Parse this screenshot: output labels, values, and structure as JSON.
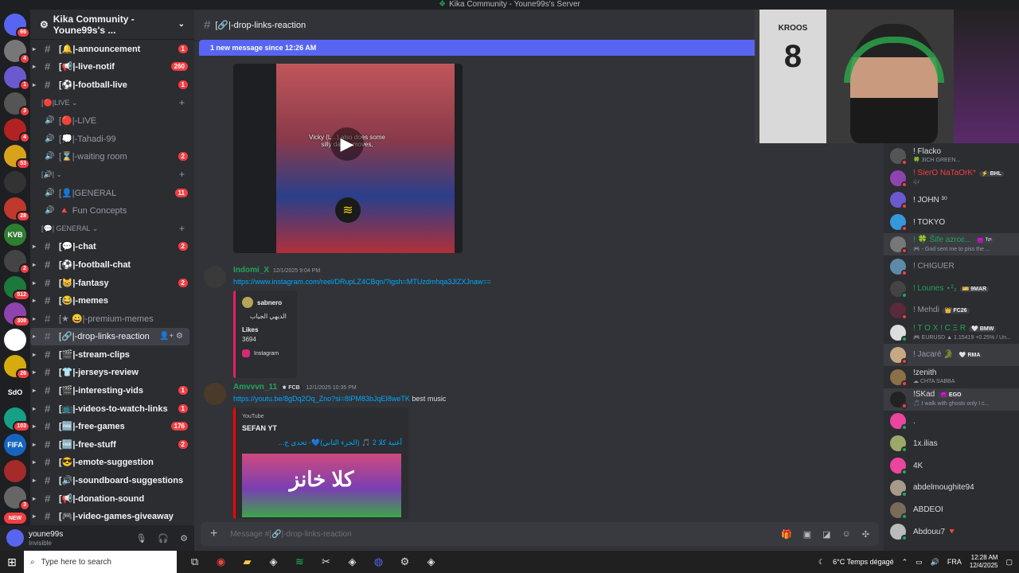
{
  "window": {
    "title": "Kika Community - Youne99s's Server"
  },
  "servers": [
    {
      "label": "",
      "badge": "66",
      "color": "#5865f2"
    },
    {
      "label": "",
      "badge": "4",
      "color": "#777777"
    },
    {
      "label": "",
      "badge": "1",
      "color": "#6a5acd"
    },
    {
      "label": "",
      "badge": "3",
      "color": "#555555"
    },
    {
      "label": "",
      "badge": "4",
      "color": "#b22222"
    },
    {
      "label": "",
      "badge": "53",
      "color": "#d9a21b"
    },
    {
      "label": "",
      "badge": "",
      "color": "#333333"
    },
    {
      "label": "",
      "badge": "28",
      "color": "#c0392b"
    },
    {
      "label": "KVB",
      "badge": "",
      "color": "#2e7d32"
    },
    {
      "label": "",
      "badge": "2",
      "color": "#444444"
    },
    {
      "label": "",
      "badge": "512",
      "color": "#1b7a3a"
    },
    {
      "label": "",
      "badge": "308",
      "color": "#8e44ad"
    },
    {
      "label": "",
      "badge": "",
      "color": "#ffffff"
    },
    {
      "label": "",
      "badge": "26",
      "color": "#d4ac0d"
    },
    {
      "label": "SdO",
      "badge": "",
      "color": "#1e1f22"
    },
    {
      "label": "",
      "badge": "103",
      "color": "#16a085"
    },
    {
      "label": "FIFA",
      "badge": "",
      "color": "#1565c0"
    },
    {
      "label": "",
      "badge": "",
      "color": "#a52a2a"
    },
    {
      "label": "",
      "badge": "3",
      "color": "#666666"
    },
    {
      "label": "NEW",
      "badge": "",
      "color": "#f23f43"
    }
  ],
  "guild": {
    "name": "Kika Community - Youne99s's ..."
  },
  "channels": [
    {
      "type": "text",
      "name": "[🔔|-announcement",
      "badge": "1",
      "state": "bright"
    },
    {
      "type": "text",
      "name": "[📢|-live-notif",
      "badge": "260",
      "state": "bright"
    },
    {
      "type": "text",
      "name": "[⚽|-football-live",
      "badge": "1",
      "state": "bright"
    },
    {
      "type": "cat",
      "name": "[🔴|LIVE ⌄"
    },
    {
      "type": "voice",
      "name": "[🔴|-LIVE",
      "badge": "",
      "state": "muted"
    },
    {
      "type": "voice",
      "name": "[💭|-Tahadi-99",
      "badge": "",
      "state": "muted"
    },
    {
      "type": "voice",
      "name": "[⌛|-waiting room",
      "badge": "2",
      "state": "muted"
    },
    {
      "type": "cat",
      "name": "[🔊| ⌄"
    },
    {
      "type": "voice",
      "name": "[👤|GENERAL",
      "badge": "11",
      "state": "muted"
    },
    {
      "type": "voice",
      "name": "🔺 Fun Concepts",
      "badge": "",
      "state": "muted"
    },
    {
      "type": "cat",
      "name": "[💬| GENERAL ⌄"
    },
    {
      "type": "text",
      "name": "[💬|-chat",
      "badge": "2",
      "state": "bright"
    },
    {
      "type": "text",
      "name": "[⚽|-football-chat",
      "badge": "",
      "state": "bright"
    },
    {
      "type": "text",
      "name": "[😸|-fantasy",
      "badge": "2",
      "state": "bright"
    },
    {
      "type": "text",
      "name": "[😂|-memes",
      "badge": "",
      "state": "bright"
    },
    {
      "type": "text",
      "name": "[★ 😀|-premium-memes",
      "badge": "",
      "state": "muted"
    },
    {
      "type": "text",
      "name": "[🔗|-drop-links-reaction",
      "badge": "",
      "state": "active"
    },
    {
      "type": "text",
      "name": "[🎬|-stream-clips",
      "badge": "",
      "state": "bright"
    },
    {
      "type": "text",
      "name": "[👕|-jerseys-review",
      "badge": "",
      "state": "bright"
    },
    {
      "type": "text",
      "name": "[🎬|-interesting-vids",
      "badge": "1",
      "state": "bright"
    },
    {
      "type": "text",
      "name": "[📺|-videos-to-watch-links",
      "badge": "1",
      "state": "bright"
    },
    {
      "type": "text",
      "name": "[🆓|-free-games",
      "badge": "176",
      "state": "bright"
    },
    {
      "type": "text",
      "name": "[🆓|-free-stuff",
      "badge": "2",
      "state": "bright"
    },
    {
      "type": "text",
      "name": "[😎|-emote-suggestion",
      "badge": "",
      "state": "bright"
    },
    {
      "type": "text",
      "name": "[🔊|-soundboard-suggestions",
      "badge": "",
      "state": "bright"
    },
    {
      "type": "text",
      "name": "[📢|-donation-sound",
      "badge": "",
      "state": "bright"
    },
    {
      "type": "text",
      "name": "[🎮|-video-games-giveaway",
      "badge": "",
      "state": "bright"
    }
  ],
  "user": {
    "name": "youne99s",
    "status": "Invisible"
  },
  "header": {
    "channel": "[🔗|-drop-links-reaction"
  },
  "newbar": {
    "text": "1 new message since 12:26 AM"
  },
  "video": {
    "caption": "Vicky (L...) also does some silly dance moves,"
  },
  "messages": [
    {
      "author": "Indomi_X",
      "color": "#23a55a",
      "tag": "",
      "time": "12/1/2025 9:04 PM",
      "link": "https://www.instagram.com/reel/DRupLZ4CBqn/?igsh=MTUzdmhqa3JlZXJnaw==",
      "text": "",
      "embed": {
        "author": "sabnero",
        "ar": "الديهي الجياب",
        "likes_label": "Likes",
        "likes": "3694",
        "provider": "Instagram"
      }
    },
    {
      "author": "Amvvvn_11",
      "color": "#23a55a",
      "tag": "⚜ FCB",
      "time": "12/1/2025 10:35 PM",
      "link": "https://youtu.be/8gDq2Oq_Zno?si=8IPM83bJqEI8weTK",
      "text": "best music",
      "embed": {
        "provider": "YouTube",
        "channel": "SEFAN YT",
        "title": "أغنية كلا 2 🎵 (الجزء الثاني)💙- تحدي ج...",
        "thumb": "كلا خانز"
      }
    }
  ],
  "composer": {
    "placeholder": "Message #[🔗|-drop-links-reaction"
  },
  "cam": {
    "shirt_name": "KROOS",
    "shirt_num": "8"
  },
  "members": [
    {
      "name": "! Flacko",
      "sub": "🍀 3ICH GREEN...",
      "color": "#dbdee1",
      "tag": "",
      "av": "#555",
      "st": "#f23f43"
    },
    {
      "name": "! SierO NaTaOrK*",
      "sub": "🎶",
      "color": "#f23f43",
      "tag": "⚡ BHL",
      "av": "#8e44ad",
      "st": "#f23f43"
    },
    {
      "name": "! JOHN ³⁰",
      "sub": "",
      "color": "#dbdee1",
      "tag": "",
      "av": "#6a5acd",
      "st": "#f23f43"
    },
    {
      "name": "! TOKYO",
      "sub": "",
      "color": "#dbdee1",
      "tag": "",
      "av": "#3498db",
      "st": "#f23f43"
    },
    {
      "name": "! 🍀 Ŝife azroɛ...",
      "sub": "🎮 - God sent me to piss the ...",
      "color": "#23a55a",
      "tag": "😈 ᵀᶻ¹",
      "av": "#777",
      "st": "#f23f43",
      "hl": true
    },
    {
      "name": "! CHIGUER",
      "sub": "",
      "color": "#949ba4",
      "tag": "",
      "av": "#5d8aa8",
      "st": "#f23f43"
    },
    {
      "name": "! Lounes ⋆²₂",
      "sub": "",
      "color": "#23a55a",
      "tag": "🎫 9MAR",
      "av": "#444",
      "st": "#23a55a"
    },
    {
      "name": "! Mehdi",
      "sub": "",
      "color": "#949ba4",
      "tag": "👑 FC26",
      "av": "#5a2a3a",
      "st": "#f23f43"
    },
    {
      "name": "! T O X ! C Ξ R",
      "sub": "🎮 EURUSD ▲ 1.15419 +0.25% / Un...",
      "color": "#23a55a",
      "tag": "🤍 BMW",
      "av": "#ddd",
      "st": "#23a55a"
    },
    {
      "name": "! Jacaré 🐊",
      "sub": "",
      "color": "#949ba4",
      "tag": "🤍 RMA",
      "av": "#c8a882",
      "st": "#f23f43",
      "hl": true
    },
    {
      "name": "!zenith",
      "sub": "☁ CHTA SABBA",
      "color": "#dbdee1",
      "tag": "",
      "av": "#8b6f47",
      "st": "#f23f43"
    },
    {
      "name": "!SKad",
      "sub": "🎵 I walk with ghosts only I c...",
      "color": "#dbdee1",
      "tag": "😈 EGO",
      "av": "#222",
      "st": "#f23f43",
      "hl": true
    },
    {
      "name": ".",
      "sub": "",
      "color": "#dbdee1",
      "tag": "",
      "av": "#eb459e",
      "st": "#23a55a"
    },
    {
      "name": "1x.ilias",
      "sub": "",
      "color": "#dbdee1",
      "tag": "",
      "av": "#9aa86a",
      "st": "#23a55a"
    },
    {
      "name": "4K",
      "sub": "",
      "color": "#dbdee1",
      "tag": "",
      "av": "#eb459e",
      "st": "#23a55a"
    },
    {
      "name": "abdelmoughite94",
      "sub": "",
      "color": "#dbdee1",
      "tag": "",
      "av": "#a89a8a",
      "st": "#23a55a"
    },
    {
      "name": "ABDEOI",
      "sub": "",
      "color": "#dbdee1",
      "tag": "",
      "av": "#7a6a5a",
      "st": "#23a55a"
    },
    {
      "name": "Abdouu7 🔻",
      "sub": "",
      "color": "#dbdee1",
      "tag": "",
      "av": "#bbb",
      "st": "#23a55a"
    }
  ],
  "taskbar": {
    "search": "Type here to search",
    "weather": "6°C  Temps dégagé",
    "lang": "FRA",
    "time": "12:28 AM",
    "date": "12/4/2025",
    "apps": [
      "chrome-icon",
      "explorer-icon",
      "app-icon",
      "spotify-icon",
      "capcut-icon",
      "app-icon",
      "discord-icon",
      "settings-icon",
      "app-icon"
    ]
  }
}
